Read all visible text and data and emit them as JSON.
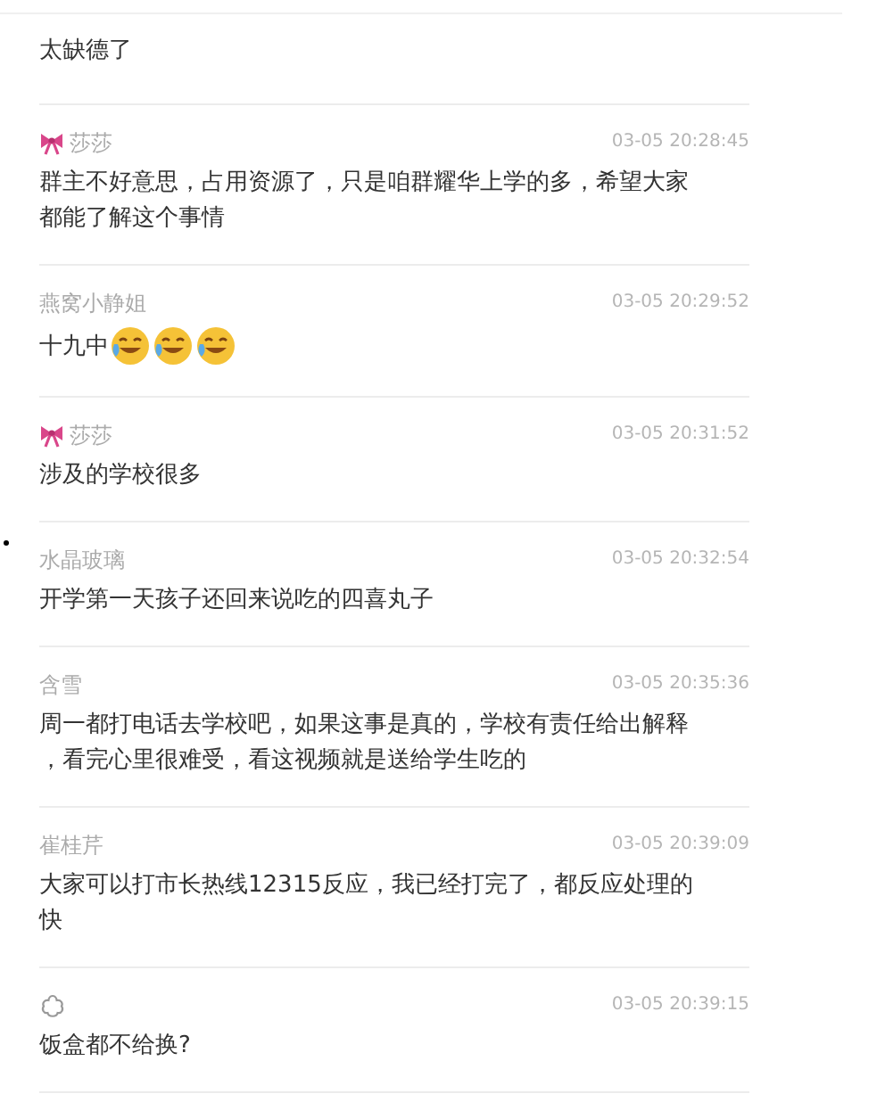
{
  "comments": [
    {
      "kind": "plain",
      "text": "太缺德了"
    },
    {
      "kind": "bow",
      "name": "莎莎",
      "time": "03-05 20:28:45",
      "text": "群主不好意思，占用资源了，只是咱群耀华上学的多，希望大家都能了解这个事情"
    },
    {
      "kind": "plain",
      "name": "燕窝小静姐",
      "time": "03-05 20:29:52",
      "text": "十九中",
      "emojis": [
        {
          "kind": "laugh-cry"
        },
        {
          "kind": "laugh-cry"
        },
        {
          "kind": "laugh-cry"
        }
      ]
    },
    {
      "kind": "bow",
      "name": "莎莎",
      "time": "03-05 20:31:52",
      "text": "涉及的学校很多"
    },
    {
      "kind": "plain",
      "name": "水晶玻璃",
      "time": "03-05 20:32:54",
      "text": "开学第一天孩子还回来说吃的四喜丸子"
    },
    {
      "kind": "plain",
      "name": "含雪",
      "time": "03-05 20:35:36",
      "text": "周一都打电话去学校吧，如果这事是真的，学校有责任给出解释，看完心里很难受，看这视频就是送给学生吃的"
    },
    {
      "kind": "plain",
      "name": "崔桂芹",
      "time": "03-05 20:39:09",
      "text": "大家可以打市长热线12315反应，我已经打完了，都反应处理的快"
    },
    {
      "kind": "flower",
      "time": "03-05 20:39:15",
      "text": "饭盒都不给换?"
    }
  ]
}
